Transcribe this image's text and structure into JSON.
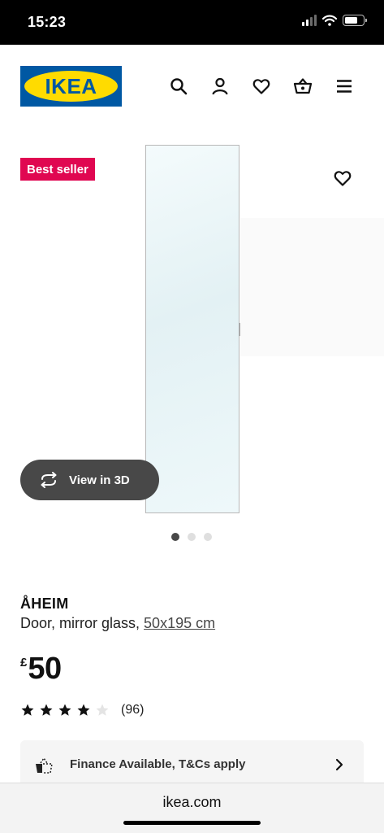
{
  "status_bar": {
    "time": "15:23",
    "icons": [
      "signal-icon",
      "wifi-icon",
      "battery-icon"
    ]
  },
  "header": {
    "logo_text": "IKEA",
    "icons": [
      "search-icon",
      "account-icon",
      "wishlist-heart-icon",
      "shopping-bag-icon",
      "menu-icon"
    ],
    "colors": {
      "logo_blue": "#0058a3",
      "logo_yellow": "#ffdb00"
    }
  },
  "gallery": {
    "badge": "Best seller",
    "badge_color": "#e00751",
    "view_3d_label": "View in 3D",
    "image_count": 3,
    "active_image": 1
  },
  "product": {
    "name": "ÅHEIM",
    "description": "Door, mirror glass, ",
    "size_link": "50x195 cm",
    "price_currency": "£",
    "price_amount": "50",
    "rating_stars": 4,
    "rating_max": 5,
    "review_count": "(96)"
  },
  "finance": {
    "label": "Finance Available, T&Cs apply"
  },
  "browser": {
    "url": "ikea.com"
  }
}
